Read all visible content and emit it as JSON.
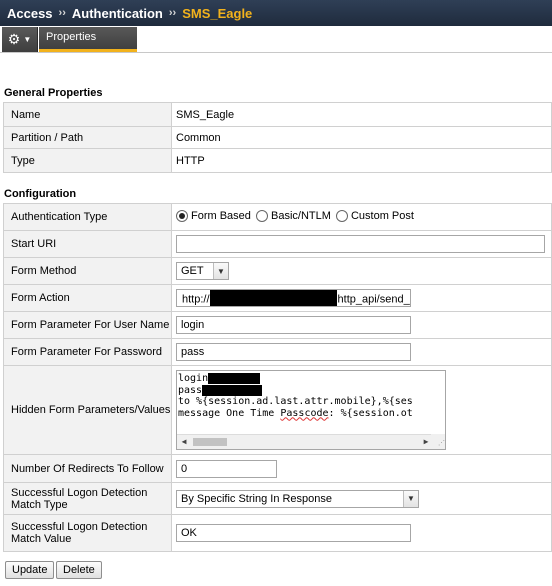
{
  "breadcrumb": {
    "items": [
      "Access",
      "Authentication"
    ],
    "separator": "››",
    "current": "SMS_Eagle"
  },
  "tabs": {
    "gear_icon": "gear-icon",
    "active_tab": "Properties"
  },
  "general": {
    "heading": "General Properties",
    "rows": [
      {
        "label": "Name",
        "value": "SMS_Eagle"
      },
      {
        "label": "Partition / Path",
        "value": "Common"
      },
      {
        "label": "Type",
        "value": "HTTP"
      }
    ]
  },
  "config": {
    "heading": "Configuration",
    "auth_type": {
      "label": "Authentication Type",
      "options": [
        "Form Based",
        "Basic/NTLM",
        "Custom Post"
      ],
      "selected": "Form Based"
    },
    "start_uri": {
      "label": "Start URI",
      "value": ""
    },
    "form_method": {
      "label": "Form Method",
      "value": "GET"
    },
    "form_action": {
      "label": "Form Action",
      "prefix": "http://",
      "suffix": "http_api/send_s"
    },
    "param_user": {
      "label": "Form Parameter For User Name",
      "value": "login"
    },
    "param_pass": {
      "label": "Form Parameter For Password",
      "value": "pass"
    },
    "hidden_params": {
      "label": "Hidden Form Parameters/Values",
      "line1": "login",
      "line2": "pass",
      "line3": "to %{session.ad.last.attr.mobile},%{ses",
      "line4_pre": "message One Time ",
      "line4_word": "Passcode",
      "line4_post": ": %{session.ot"
    },
    "redirects": {
      "label": "Number Of Redirects To Follow",
      "value": "0"
    },
    "match_type": {
      "label": "Successful Logon Detection Match Type",
      "value": "By Specific String In Response"
    },
    "match_value": {
      "label": "Successful Logon Detection Match Value",
      "value": "OK"
    }
  },
  "actions": {
    "update_label": "Update",
    "delete_label": "Delete"
  }
}
